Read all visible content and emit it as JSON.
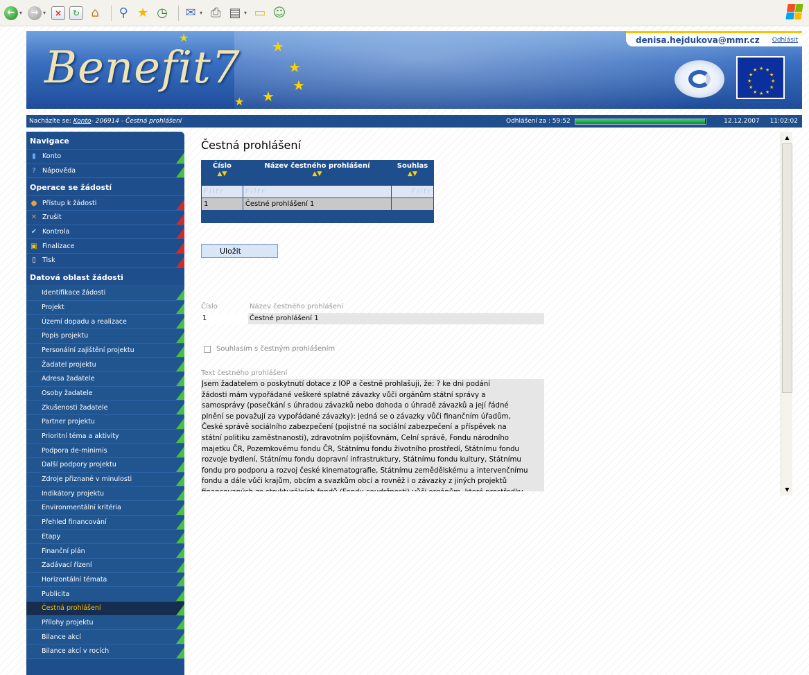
{
  "toolbar": {
    "icons": [
      "back-icon",
      "forward-icon",
      "stop-icon",
      "refresh-icon",
      "home-icon",
      "search-icon",
      "favorites-icon",
      "history-icon",
      "mail-icon",
      "print-icon",
      "edit-icon",
      "folder-icon",
      "messenger-icon"
    ],
    "winlogo_colors": [
      "#f25022",
      "#7fba00",
      "#00a4ef",
      "#ffb900"
    ]
  },
  "header": {
    "logo_text": "Benefit7",
    "user_email": "denisa.hejdukova@mmr.cz",
    "logout_label": "Odhlásit"
  },
  "crumbbar": {
    "prefix": "Nacházíte se:",
    "link": "Konto",
    "current": " - 206914 - Čestná prohlášení",
    "timer_label": "Odhlášení za : 59:52",
    "timer_fraction": 0.998,
    "date": "12.12.2007",
    "time": "11:02:02"
  },
  "sidebar": {
    "nav_title": "Navigace",
    "nav_items": [
      {
        "label": "Konto",
        "icon": "book-icon"
      },
      {
        "label": "Nápověda",
        "icon": "help-icon"
      }
    ],
    "ops_title": "Operace se žádostí",
    "ops_items": [
      {
        "label": "Přístup k žádosti",
        "icon": "users-icon"
      },
      {
        "label": "Zrušit",
        "icon": "cross-icon"
      },
      {
        "label": "Kontrola",
        "icon": "check-icon"
      },
      {
        "label": "Finalizace",
        "icon": "lock-icon"
      },
      {
        "label": "Tisk",
        "icon": "document-icon"
      }
    ],
    "data_title": "Datová oblast žádosti",
    "data_items": [
      "Identifikace žádosti",
      "Projekt",
      "Území dopadu a realizace",
      "Popis projektu",
      "Personální zajištění projektu",
      "Žadatel projektu",
      "Adresa žadatele",
      "Osoby žadatele",
      "Zkušenosti žadatele",
      "Partner projektu",
      "Prioritní téma a aktivity",
      "Podpora de-minimis",
      "Další podpory projektu",
      "Zdroje přiznané v minulosti",
      "Indikátory projektu",
      "Environmentální kritéria",
      "Přehled financování",
      "Etapy",
      "Finanční plán",
      "Zadávací řízení",
      "Horizontální témata",
      "Publicita",
      "Čestná prohlášení",
      "Přílohy projektu",
      "Bilance akcí",
      "Bilance akcí v rocích"
    ],
    "active_item": "Čestná prohlášení"
  },
  "main": {
    "title": "Čestná prohlášení",
    "table": {
      "col_number": "Číslo",
      "col_name": "Název čestného prohlášení",
      "col_agree": "Souhlas",
      "sort_glyph": "▲▼",
      "filter_placeholder": "Filtr",
      "rows": [
        {
          "number": "1",
          "name": "Čestné prohlášení 1",
          "agree": ""
        }
      ]
    },
    "save_label": "Uložit",
    "detail": {
      "number_label": "Číslo",
      "number_value": "1",
      "name_label": "Název čestného prohlášení",
      "name_value": "Čestné prohlášení 1",
      "agree_label": "Souhlasím s čestným prohlášením",
      "agree_checked": false,
      "text_label": "Text čestného prohlášení",
      "text_lines": [
        "Jsem žadatelem o poskytnutí dotace z IOP a čestně prohlašuji, že: ? ke dni podání",
        "žádosti mám vypořádané veškeré splatné závazky vůči orgánům státní správy a",
        "samosprávy (posečkání s úhradou závazků nebo dohoda o úhradě závazků a její řádné",
        "plnění se považují za vypořádané závazky): jedná se o závazky vůči finančním úřadům,",
        "České správě sociálního zabezpečení (pojistné na sociální zabezpečení a příspěvek na",
        "státní politiku zaměstnanosti), zdravotním pojišťovnám, Celní správě, Fondu národního",
        "majetku ČR, Pozemkovému fondu ČR, Státnímu fondu životního prostředí, Státnímu fondu",
        "rozvoje bydlení, Státnímu fondu dopravní infrastruktury, Státnímu fondu kultury, Státnímu",
        "fondu pro podporu a rozvoj české kinematografie, Státnímu zemědělskému a intervenčnímu",
        "fondu a dále vůči krajům, obcím a svazkům obcí a rovněž i o závazky z jiných projektů",
        "financovaných ze strukturálních fondů (Fondu soudržnosti) vůči orgánům, které prostředky"
      ]
    }
  },
  "colors": {
    "sidebar_bg": "#1f4e8c",
    "active_text": "#f5c400",
    "ok_corner": "#4bbf43",
    "warn_corner": "#d02a2a"
  }
}
